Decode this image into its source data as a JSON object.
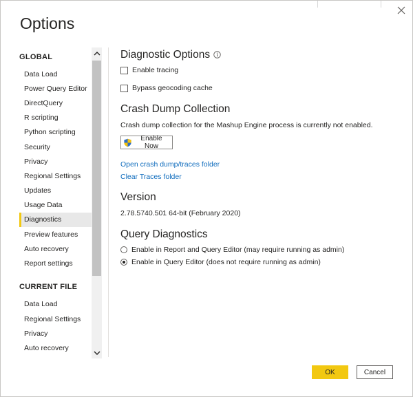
{
  "dialog": {
    "title": "Options",
    "close_icon": "close-icon"
  },
  "sidebar": {
    "global_heading": "GLOBAL",
    "global_items": [
      {
        "label": "Data Load"
      },
      {
        "label": "Power Query Editor"
      },
      {
        "label": "DirectQuery"
      },
      {
        "label": "R scripting"
      },
      {
        "label": "Python scripting"
      },
      {
        "label": "Security"
      },
      {
        "label": "Privacy"
      },
      {
        "label": "Regional Settings"
      },
      {
        "label": "Updates"
      },
      {
        "label": "Usage Data"
      },
      {
        "label": "Diagnostics",
        "selected": true
      },
      {
        "label": "Preview features"
      },
      {
        "label": "Auto recovery"
      },
      {
        "label": "Report settings"
      }
    ],
    "current_file_heading": "CURRENT FILE",
    "current_file_items": [
      {
        "label": "Data Load"
      },
      {
        "label": "Regional Settings"
      },
      {
        "label": "Privacy"
      },
      {
        "label": "Auto recovery"
      }
    ],
    "accent_color": "#f2c811"
  },
  "main": {
    "diagnostic_options": {
      "heading": "Diagnostic Options",
      "info_icon": "info-icon",
      "enable_tracing": {
        "label": "Enable tracing",
        "checked": false
      },
      "bypass_geocoding": {
        "label": "Bypass geocoding cache",
        "checked": false
      }
    },
    "crash_dump": {
      "heading": "Crash Dump Collection",
      "description": "Crash dump collection for the Mashup Engine process is currently not enabled.",
      "enable_button": "Enable Now",
      "enable_button_icon": "shield-icon",
      "open_link": "Open crash dump/traces folder",
      "clear_link": "Clear Traces folder",
      "link_color": "#0f6cbd"
    },
    "version": {
      "heading": "Version",
      "value": "2.78.5740.501 64-bit (February 2020)"
    },
    "query_diagnostics": {
      "heading": "Query Diagnostics",
      "options": [
        {
          "label": "Enable in Report and Query Editor (may require running as admin)",
          "selected": false
        },
        {
          "label": "Enable in Query Editor (does not require running as admin)",
          "selected": true
        }
      ]
    }
  },
  "footer": {
    "ok_label": "OK",
    "cancel_label": "Cancel",
    "ok_color": "#f2c811"
  }
}
